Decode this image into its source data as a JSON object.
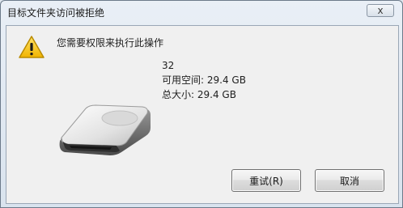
{
  "window": {
    "title": "目标文件夹访问被拒绝",
    "close_glyph": "x"
  },
  "message": {
    "heading": "您需要权限来执行此操作",
    "icon": "warning-icon"
  },
  "drive": {
    "name": "32",
    "free_space": "可用空间: 29.4 GB",
    "total_size": "总大小: 29.4 GB",
    "icon": "removable-drive-icon"
  },
  "buttons": {
    "retry_label": "重试(R)",
    "cancel_label": "取消"
  },
  "colors": {
    "warning": "#f3c21b",
    "frame": "#dfe7ef"
  }
}
